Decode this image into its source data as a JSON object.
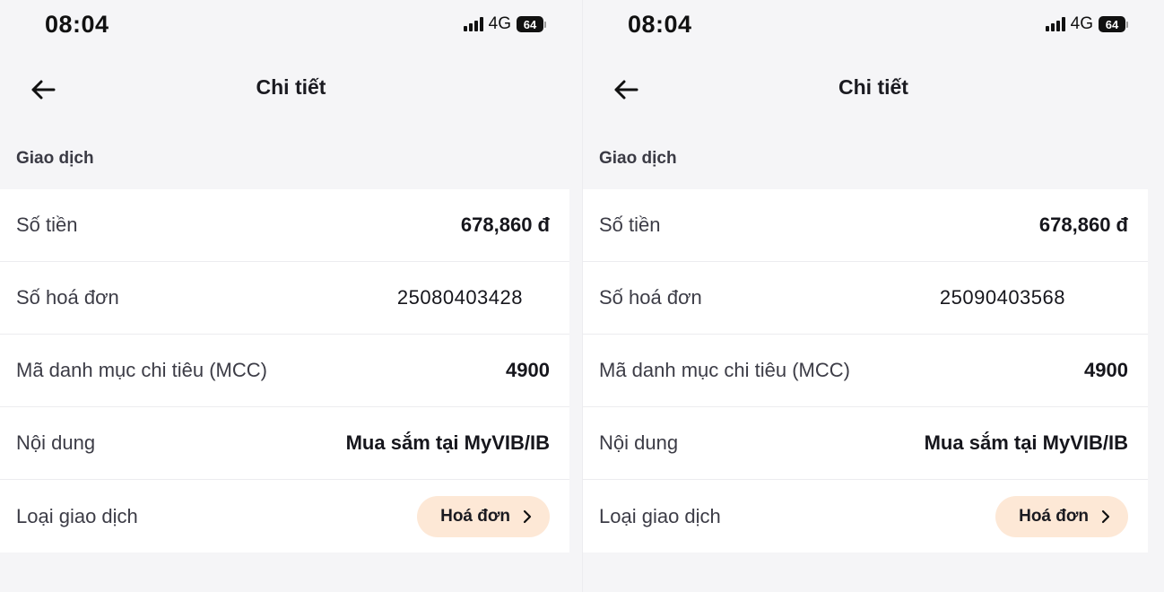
{
  "screens": [
    {
      "status": {
        "time": "08:04",
        "network": "4G",
        "battery": "64"
      },
      "header": {
        "title": "Chi tiết"
      },
      "section_title": "Giao dịch",
      "rows": [
        {
          "label": "Số tiền",
          "value": "678,860 đ"
        },
        {
          "label": "Số hoá đơn",
          "value": "25080403428"
        },
        {
          "label": "Mã danh mục chi tiêu (MCC)",
          "value": "4900"
        },
        {
          "label": "Nội dung",
          "value": "Mua sắm tại MyVIB/IB"
        }
      ],
      "type_row": {
        "label": "Loại giao dịch",
        "button_label": "Hoá đơn"
      }
    },
    {
      "status": {
        "time": "08:04",
        "network": "4G",
        "battery": "64"
      },
      "header": {
        "title": "Chi tiết"
      },
      "section_title": "Giao dịch",
      "rows": [
        {
          "label": "Số tiền",
          "value": "678,860 đ"
        },
        {
          "label": "Số hoá đơn",
          "value": "25090403568"
        },
        {
          "label": "Mã danh mục chi tiêu (MCC)",
          "value": "4900"
        },
        {
          "label": "Nội dung",
          "value": "Mua sắm tại MyVIB/IB"
        }
      ],
      "type_row": {
        "label": "Loại giao dịch",
        "button_label": "Hoá đơn"
      }
    }
  ],
  "colors": {
    "pill_background": "#fde8d6",
    "page_background": "#f5f5f7",
    "card_background": "#ffffff"
  },
  "icons": {
    "back": "arrow-left-icon",
    "chevron": "chevron-right-icon",
    "signal": "signal-icon",
    "battery": "battery-icon"
  }
}
